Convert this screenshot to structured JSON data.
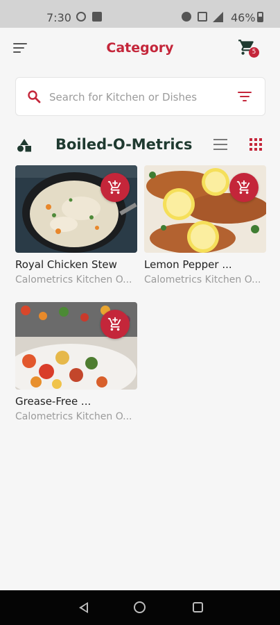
{
  "status_bar": {
    "time": "7:30",
    "battery": "46%"
  },
  "app_bar": {
    "title": "Category",
    "cart_count": "5"
  },
  "search": {
    "placeholder": "Search for Kitchen or Dishes",
    "value": ""
  },
  "section": {
    "title": "Boiled-O-Metrics"
  },
  "colors": {
    "accent": "#c4263a",
    "heading": "#1f3a30",
    "muted_text": "#9b9b9b"
  },
  "products": [
    {
      "name": "Royal Chicken Stew",
      "kitchen": "Calometrics Kitchen O...",
      "image": "chicken-stew-photo"
    },
    {
      "name": "Lemon Pepper ...",
      "kitchen": "Calometrics Kitchen O...",
      "image": "lemon-pepper-chicken-photo"
    },
    {
      "name": "Grease-Free ...",
      "kitchen": "Calometrics Kitchen O...",
      "image": "roasted-vegetables-photo"
    }
  ]
}
